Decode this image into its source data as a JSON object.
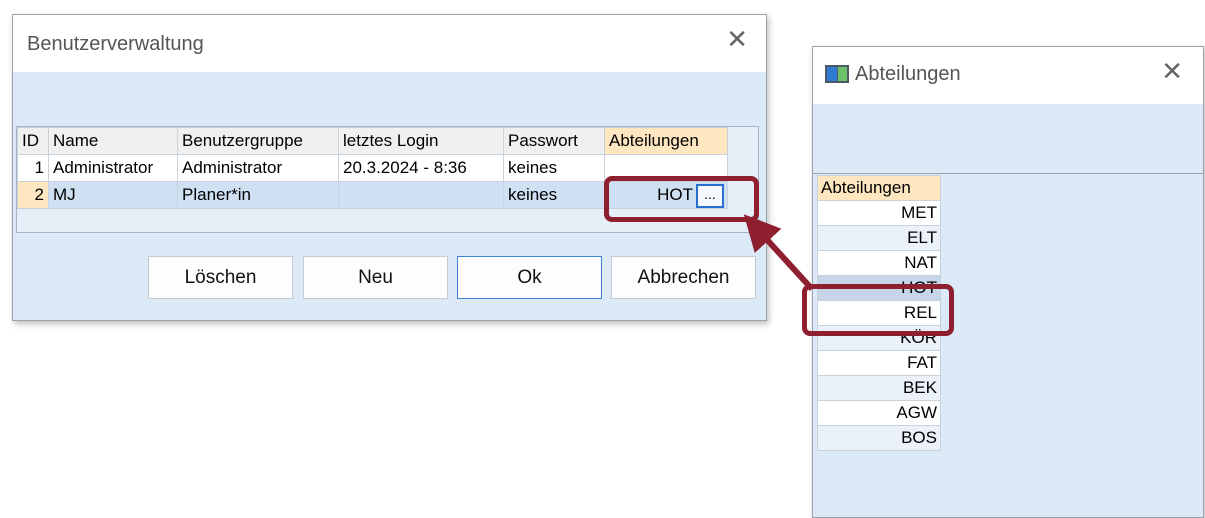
{
  "user_window": {
    "title": "Benutzerverwaltung",
    "close_glyph": "✕",
    "columns": [
      "ID",
      "Name",
      "Benutzergruppe",
      "letztes Login",
      "Passwort",
      "Abteilungen"
    ],
    "rows": [
      {
        "id": "1",
        "name": "Administrator",
        "group": "Administrator",
        "last_login": "20.3.2024 - 8:36",
        "password": "keines",
        "departments": ""
      },
      {
        "id": "2",
        "name": "MJ",
        "group": "Planer*in",
        "last_login": "",
        "password": "keines",
        "departments": "HOT"
      }
    ],
    "ellipsis": "...",
    "buttons": {
      "delete": "Löschen",
      "new": "Neu",
      "ok": "Ok",
      "cancel": "Abbrechen"
    }
  },
  "department_window": {
    "title": "Abteilungen",
    "close_glyph": "✕",
    "header": "Abteilungen",
    "items": [
      "MET",
      "ELT",
      "NAT",
      "HOT",
      "REL",
      "KÖR",
      "FAT",
      "BEK",
      "AGW",
      "BOS"
    ],
    "selected": "HOT"
  },
  "colors": {
    "highlight": "#8e1f2f",
    "accent": "#2a6fcc",
    "header_highlight": "#fde6c0"
  }
}
